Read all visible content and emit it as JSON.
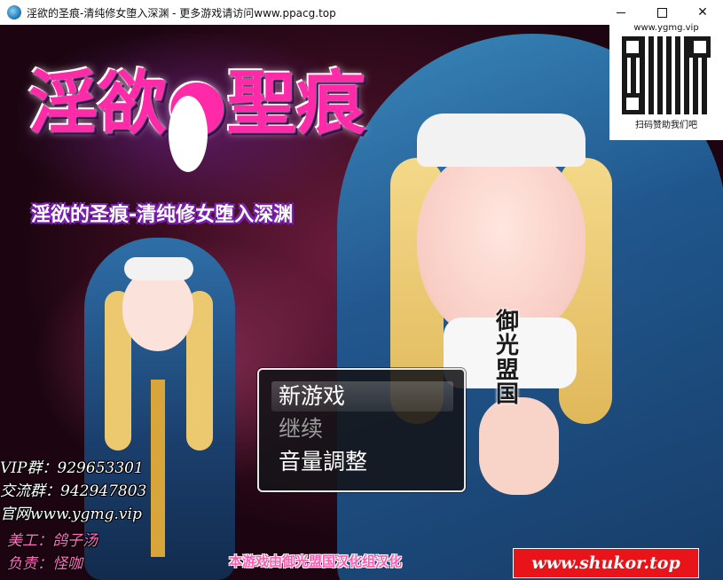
{
  "window": {
    "title": "淫欲的圣痕-清纯修女堕入深渊 - 更多游戏请访问www.ppacg.top",
    "minimize_label": "",
    "maximize_label": "",
    "close_label": "✕"
  },
  "logo": {
    "main_title": "淫欲●聖痕",
    "subtitle": "淫欲的圣痕-清纯修女堕入深渊"
  },
  "qr": {
    "site": "www.ygmg.vip",
    "caption": "扫码赞助我们吧"
  },
  "seal": {
    "chars": [
      "御",
      "光",
      "盟",
      "国"
    ]
  },
  "menu": {
    "items": [
      {
        "label": "新游戏",
        "state": "selected"
      },
      {
        "label": "继续",
        "state": "disabled"
      },
      {
        "label": "音量調整",
        "state": "normal"
      }
    ]
  },
  "info": {
    "vip_group": "VIP群：929653301",
    "chat_group": "交流群：942947803",
    "official_site": "官网www.ygmg.vip",
    "artist": "美工：鸽子汤",
    "lead": "负责：怪咖"
  },
  "credit": "本游戏由御光盟国汉化组汉化",
  "site_badge": "www.shukor.top",
  "colors": {
    "logo_pink": "#ff2aa7",
    "menu_bg": "#141418",
    "badge_red": "#e8141a"
  }
}
